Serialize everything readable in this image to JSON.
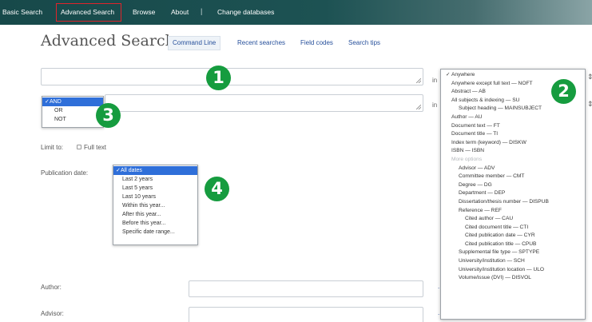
{
  "nav": {
    "items": [
      "Basic Search",
      "Advanced Search",
      "Browse",
      "About",
      "Change databases"
    ],
    "separator": "|"
  },
  "header": {
    "title": "Advanced Search",
    "command_line": "Command Line",
    "links": [
      "Recent searches",
      "Field codes",
      "Search tips"
    ]
  },
  "search_rows": {
    "in_label": "in",
    "row1_field_selected": "Anywhere",
    "row2_field": "Anywhere except full text — NOFT"
  },
  "operator_menu": {
    "options": [
      "AND",
      "OR",
      "NOT"
    ],
    "selected": "AND"
  },
  "limit_to": {
    "label": "Limit to:",
    "full_text": "Full text"
  },
  "publication_date": {
    "label": "Publication date:",
    "options": [
      "All dates",
      "Last 2 years",
      "Last 5 years",
      "Last 10 years",
      "Within this year...",
      "After this year...",
      "Before this year...",
      "Specific date range..."
    ],
    "selected": "All dates"
  },
  "field_menu": {
    "options": [
      "Anywhere",
      "Anywhere except full text — NOFT",
      "Abstract — AB",
      "All subjects & indexing — SU",
      "Subject heading — MAINSUBJECT",
      "Author — AU",
      "Document text — FT",
      "Document title — TI",
      "Index term (keyword) — DISKW",
      "ISBN — ISBN",
      "More options",
      "Advisor — ADV",
      "Committee member — CMT",
      "Degree — DG",
      "Department — DEP",
      "Dissertation/thesis number — DISPUB",
      "Reference — REF",
      "Cited author — CAU",
      "Cited document title — CTI",
      "Cited publication date — CYR",
      "Cited publication title — CPUB",
      "Supplemental file type — SPTYPE",
      "University/institution — SCH",
      "University/institution location — ULO",
      "Volume/issue (DVI) — DISVOL"
    ],
    "selected": "Anywhere"
  },
  "fields": {
    "author": "Author:",
    "advisor": "Advisor:"
  },
  "badges": [
    "1",
    "2",
    "3",
    "4"
  ],
  "colors": {
    "nav_bg": "#1d5253",
    "link": "#27509b",
    "selected": "#2f6fd9",
    "badge": "#169c3f",
    "highlight": "#e0242b"
  }
}
